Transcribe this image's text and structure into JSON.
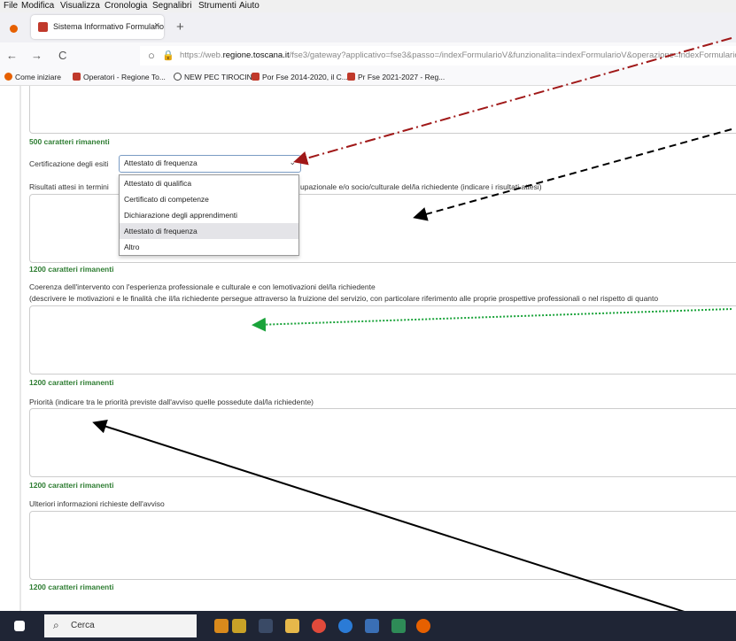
{
  "menubar": {
    "items": [
      "File",
      "Modifica",
      "Visualizza",
      "Cronologia",
      "Segnalibri",
      "Strumenti",
      "Aiuto"
    ]
  },
  "tab": {
    "title": "Sistema Informativo Formulario",
    "close": "×",
    "new_tab": "+"
  },
  "nav": {
    "back": "←",
    "forward": "→",
    "reload": "C",
    "url_prefix": "https://web.",
    "url_domain": "regione.toscana.it",
    "url_rest": "/fse3/gateway?applicativo=fse3&passo=/indexFormularioV&funzionalita=indexFormularioV&operazione=indexFormularioV"
  },
  "bookmarks": [
    {
      "label": "Come iniziare",
      "color": "#e66000"
    },
    {
      "label": "Operatori - Regione To...",
      "color": "#c0392b"
    },
    {
      "label": "NEW PEC TIROCINI",
      "color": "#444444"
    },
    {
      "label": "Por Fse 2014-2020, il C...",
      "color": "#c0392b"
    },
    {
      "label": "Pr Fse 2021-2027 - Reg...",
      "color": "#c0392b"
    }
  ],
  "form": {
    "remain_1": "500 caratteri rimanenti",
    "cert_label": "Certificazione degli esiti",
    "cert_value": "Attestato di frequenza",
    "results_label_start": "Risultati attesi in termini",
    "results_label_end": "upazionale e/o socio/culturale del/la richiedente (indicare i risultati attesi)",
    "dropdown_options": [
      "Attestato di qualifica",
      "Certificato di competenze",
      "Dichiarazione degli apprendimenti",
      "Attestato di frequenza",
      "Altro"
    ],
    "selected_option": "Attestato di frequenza",
    "remain_2": "1200 caratteri rimanenti",
    "coherence_label": "Coerenza dell'intervento con l'esperienza professionale e culturale e con lemotivazioni del/la richiedente",
    "coherence_sublabel": "(descrivere le motivazioni e le finalità che il/la richiedente persegue attraverso la fruizione del servizio, con particolare riferimento alle proprie prospettive professionali o nel rispetto di quanto",
    "remain_3": "1200 caratteri rimanenti",
    "priority_label": "Priorità (indicare tra le priorità previste dall'avviso quelle possedute dal/la richiedente)",
    "remain_4": "1200 caratteri rimanenti",
    "further_label": "Ulteriori informazioni richieste dell'avviso",
    "remain_5": "1200 caratteri rimanenti"
  },
  "taskbar": {
    "search_placeholder": "Cerca"
  },
  "colors": {
    "remain_green": "#2e7d32",
    "arrow_red": "#a01818",
    "arrow_green": "#1aa33a",
    "arrow_black": "#000000"
  }
}
